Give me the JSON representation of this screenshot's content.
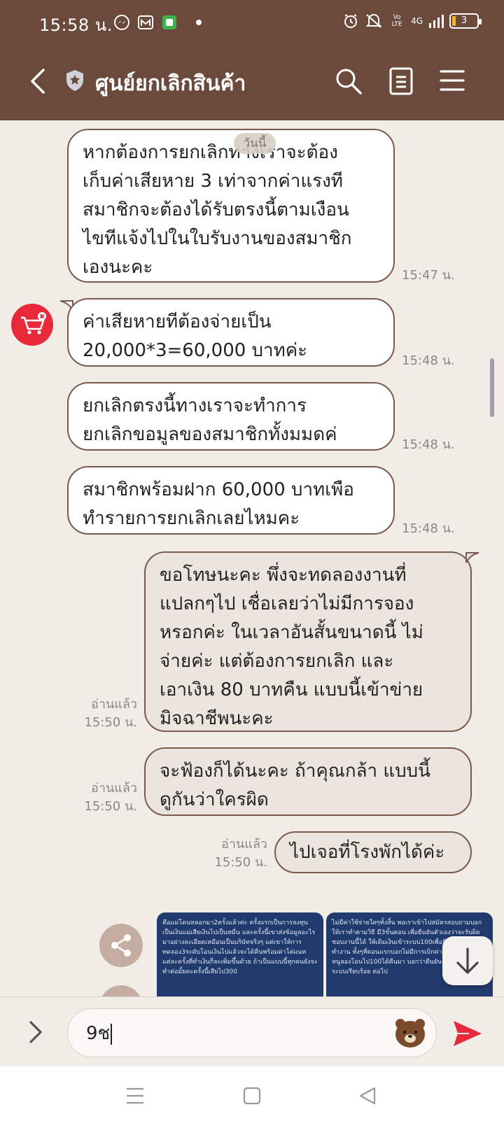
{
  "status_bar": {
    "time": "15:58 น.",
    "battery": "3",
    "network": "4G",
    "volte": "Vo LTE"
  },
  "header": {
    "title": "ศูนย์ยกเลิกสินค้า"
  },
  "chat": {
    "date_chip": "วันนี้",
    "messages": [
      {
        "dir": "in",
        "text": "หากต้องการยกเลิกทางเราจะต้อง\nเก็บค่าเสียหาย 3 เท่าจากค่าแรงที\nสมาชิกจะต้องได้รับตรงนี้ตามเงือน\nไขทีแจ้งไปในใบรับงานของสมาชิก\nเองนะคะ",
        "time": "15:47 น."
      },
      {
        "dir": "in",
        "text": "ค่าเสียหายทีต้องจ่ายเป็น\n20,000*3=60,000 บาทค่ะ",
        "time": "15:48 น."
      },
      {
        "dir": "in",
        "text": "ยกเลิกตรงนี้ทางเราจะทำการ\nยกเลิกขอมูลของสมาชิกทั้งมมดค่",
        "time": "15:48 น."
      },
      {
        "dir": "in",
        "text": "สมาชิกพร้อมฝาก 60,000 บาทเพือ\nทำรายการยกเลิกเลยไหมคะ",
        "time": "15:48 น."
      },
      {
        "dir": "out",
        "text": "ขอโทษนะคะ พึ่งจะทดลองงานที่\nแปลกๆไป เชื่อเลยว่าไม่มีการจอง\nหรอกค่ะ ในเวลาอันสั้นขนาดนี้ ไม่\nจ่ายค่ะ แต่ต้องการยกเลิก และ\nเอาเงิน 80 บาทคืน แบบนี้เข้าข่าย\nมิจฉาชีพนะคะ",
        "read": "อ่านแล้ว",
        "time": "15:50 น."
      },
      {
        "dir": "out",
        "text": "จะฟ้องก็ได้นะคะ ถ้าคุณกล้า แบบนี้\nดูกันว่าใครผิด",
        "read": "อ่านแล้ว",
        "time": "15:50 น."
      },
      {
        "dir": "out",
        "text": "ไปเจอที่โรงพักได้ค่ะ",
        "read": "อ่านแล้ว",
        "time": "15:50 น."
      }
    ],
    "image_previews": [
      {
        "text": "คือแม่โดนหลอกมา2ครั้งแล้วค่ะ ครั้งแรกเป็นการลงทุนเป็นเงินแม่เสียเงินไปเป็นหมื่น และครั้งนี้เขาส่งข้อมูลอะไรมาอย่างละเอียดเหมือนเป็นบริษัทจริงๆ แต่เขาให้การทดลอง3ระดับโอนเงินไปแล้วจะได้คืนพร้อมค่าโค่แนทแต่ละครั้งที่ทำเงินก็จะเพิ่มขึ้นด้วย ถ้าเป็นแบบนี้ทุกคนยังจะทำต่อมั้ยคะครั้งนี้เสียไป300"
      },
      {
        "text": "ไม่มีค่าใช้จ่ายใดๆทั้งสิ้น พอเราเข้าไปสมัครสอบถามบอกให้เราทำตามวิธี มี3ขั้นตอน เพื่อยืนยันตัวเองว่าจะรับผิดชอบงานนี้ได้ ให้เติมเงินเข้าระบบ100เพื่อยืนยันการทำงาน ทั้งๆที่ตอนแรกบอกไม่มีการเบิกค่าใช้จ่ายใดๆทั้งสิ้น หนูลองโอนไป100ได้คืนมา บอกว่ายืนยันการสั่งจองในระบบเรียบร้อย ต่อไป"
      }
    ]
  },
  "input_bar": {
    "value": "9ช",
    "placeholder": ""
  },
  "colors": {
    "header": "#6b4a3c",
    "bubble_border": "#7a5a4c",
    "send": "#e8293a",
    "background": "#f1ece6"
  }
}
